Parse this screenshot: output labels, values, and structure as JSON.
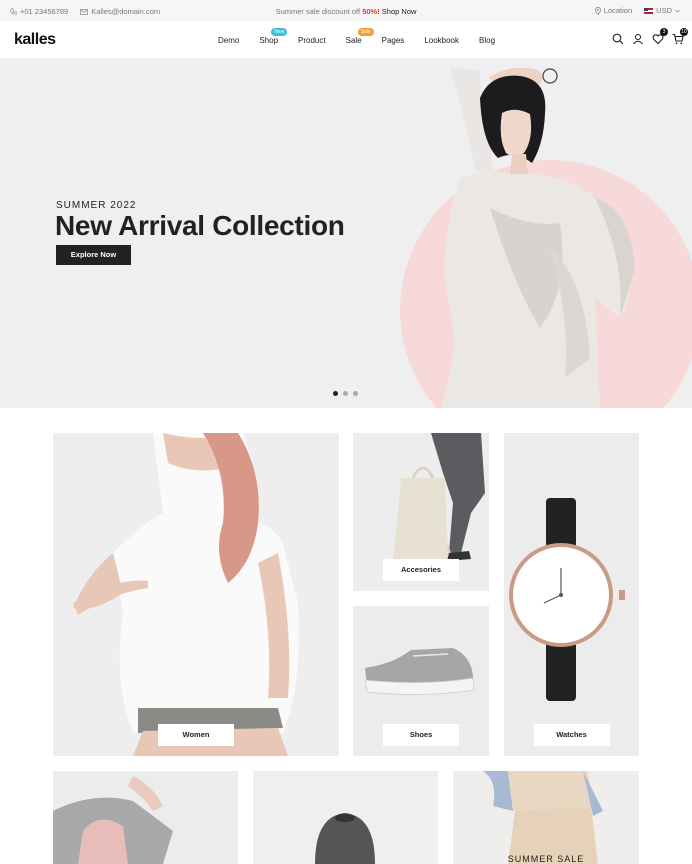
{
  "topbar": {
    "phone": "+01 23456789",
    "email": "Kalles@domain.com",
    "promo_text": "Summer sale discount off",
    "promo_pct": "50%!",
    "promo_link": "Shop Now",
    "location": "Location",
    "currency": "USD"
  },
  "header": {
    "logo": "kalles",
    "nav": [
      {
        "label": "Demo",
        "badge": ""
      },
      {
        "label": "Shop",
        "badge": "New"
      },
      {
        "label": "Product",
        "badge": ""
      },
      {
        "label": "Sale",
        "badge": "Sale"
      },
      {
        "label": "Pages",
        "badge": ""
      },
      {
        "label": "Lookbook",
        "badge": ""
      },
      {
        "label": "Blog",
        "badge": ""
      }
    ],
    "wishlist_count": "3",
    "cart_count": "10"
  },
  "hero": {
    "subtitle": "SUMMER 2022",
    "title": "New Arrival Collection",
    "button": "Explore Now",
    "slides": 3,
    "active_slide": 1
  },
  "categories": {
    "women": "Women",
    "accessories": "Accesories",
    "shoes": "Shoes",
    "watches": "Watches",
    "summer_sale": "SUMMER SALE"
  },
  "colors": {
    "accent_badge_new": "#3fbfd9",
    "accent_badge_sale": "#f0a02b",
    "promo_pct": "#e53935",
    "hero_circle": "#f7d9da"
  }
}
